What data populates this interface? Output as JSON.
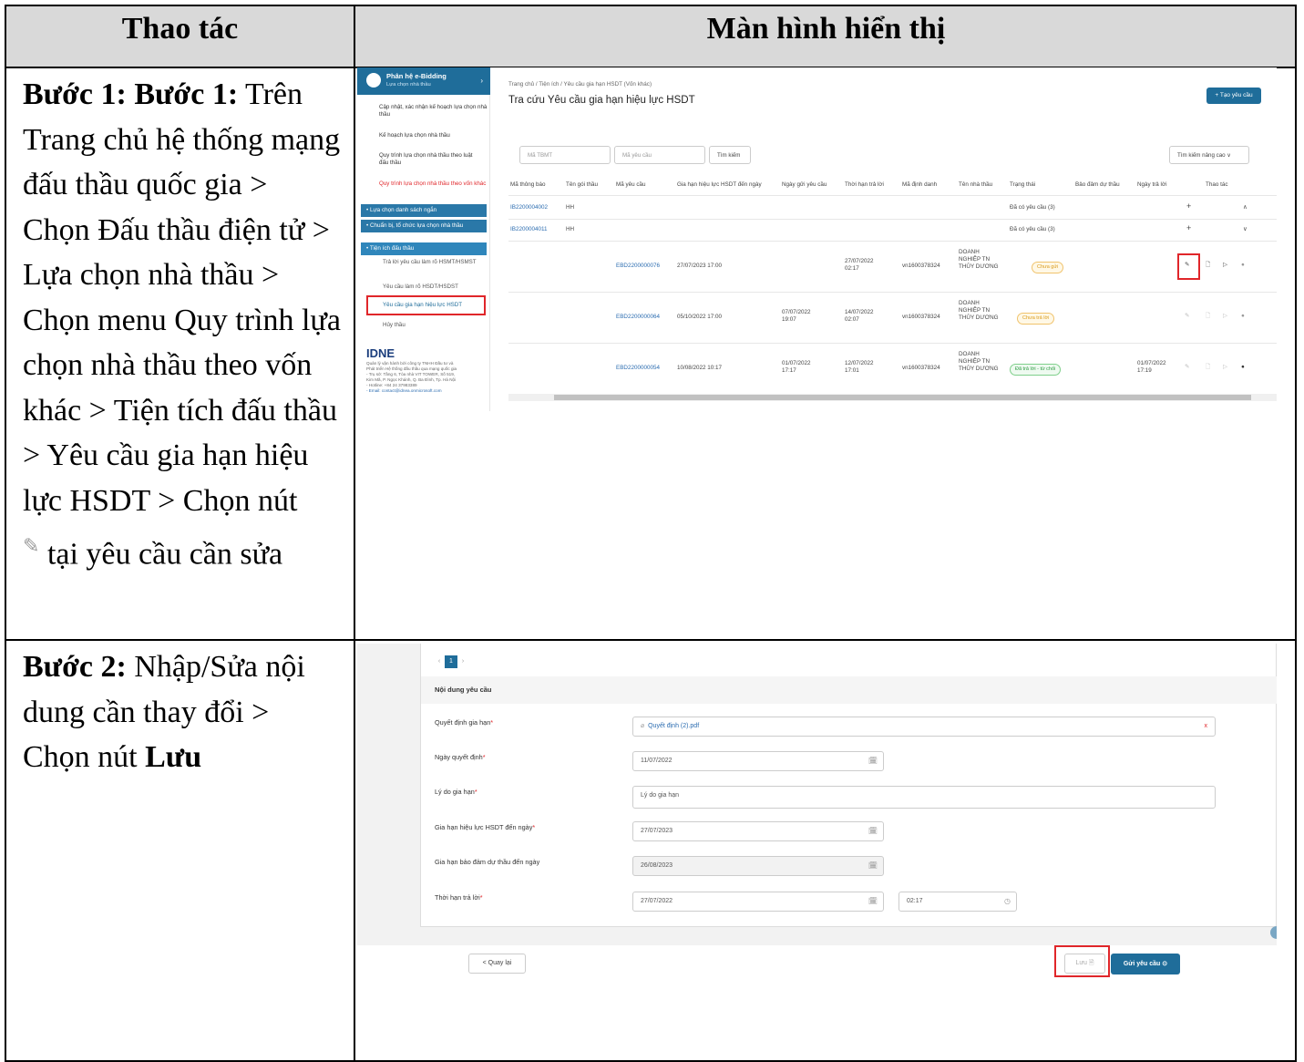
{
  "table": {
    "col_headers": [
      "Thao tác",
      "Màn hình hiển thị"
    ]
  },
  "steps": [
    {
      "lead": "Bước 1: Bước 1:",
      "text": "Trên Trang chủ hệ thống mạng đấu thầu quốc gia > Chọn Đấu thầu điện tử > Lựa chọn nhà thầu > Chọn menu Quy trình lựa chọn nhà thầu theo vốn khác > Tiện tích đấu thầu > Yêu cầu gia hạn hiệu lực HSDT > Chọn nút",
      "tail": "tại yêu cầu cần sửa",
      "icon": "pencil-icon"
    },
    {
      "lead": "Bước 2:",
      "text": "Nhập/Sửa nội dung cần thay đổi > Chọn nút",
      "bold_end": "Lưu"
    }
  ],
  "screen1": {
    "app_name": "Phân hệ e-Bidding",
    "app_sub": "Lựa chọn nhà thầu",
    "sidebar": [
      "Cập nhật, xác nhận kế hoạch lựa chọn nhà thầu",
      "Kế hoạch lựa chọn nhà thầu",
      "Quy trình lựa chọn nhà thầu theo luật đấu thầu",
      "Quy trình lựa chọn nhà thầu theo vốn khác",
      "Lựa chọn danh sách ngắn",
      "Chuẩn bị, tổ chức lựa chọn nhà thầu",
      "Tiện ích đấu thầu",
      "Trả lời yêu cầu làm rõ HSMT/HSMST",
      "Yêu cầu làm rõ HSDT/HSDST",
      "Yêu cầu gia hạn hiệu lực HSDT",
      "Hủy thầu"
    ],
    "logo": "IDNE",
    "footer": [
      "Quản lý vận hành bởi công ty TNHH Đầu tư và",
      "Phát triển Hệ thống đấu thầu qua mạng quốc gia",
      "- Trụ sở: Tầng 6, Tòa nhà VIT TOWER, Số 519,",
      "Kim Mã, P. Ngọc Khánh, Q. Ba Đình, Tp. Hà Nội",
      "- Hotline: +84 24 37983389",
      "- Email: contact@idnea.onmicrosoft.com"
    ],
    "breadcrumb": "Trang chủ / Tiện ích / Yêu cầu gia hạn HSDT (Vốn khác)",
    "title": "Tra cứu Yêu cầu gia hạn hiệu lực HSDT",
    "create_btn": "+ Tạo yêu cầu",
    "search": {
      "tbmt_ph": "Mã TBMT",
      "req_ph": "Mã yêu cầu",
      "btn": "Tìm kiếm",
      "adv": "Tìm kiếm nâng cao ∨"
    },
    "columns": [
      "Mã thông báo",
      "Tên gói thầu",
      "Mã yêu cầu",
      "Gia hạn hiệu lực HSDT đến ngày",
      "Ngày gửi yêu cầu",
      "Thời hạn trả lời",
      "Mã định danh",
      "Tên nhà thầu",
      "Trạng thái",
      "Bảo đảm dự thầu",
      "Ngày trả lời",
      "Thao tác"
    ],
    "groups": [
      {
        "code": "IB2200004002",
        "name": "HH",
        "status": "Đã có yêu cầu (3)",
        "toggle": "∧"
      },
      {
        "code": "IB2200004011",
        "name": "HH",
        "status": "Đã có yêu cầu (3)",
        "toggle": "∨"
      }
    ],
    "rows": [
      {
        "req": "EBD2200000076",
        "until": "27/07/2023 17:00",
        "sent": "",
        "reply_by": "27/07/2022 02:17",
        "id": "vn1600378324",
        "bidder": "DOANH NGHIỆP TN THỦY DƯƠNG",
        "status": "Chưa gửi",
        "answered": ""
      },
      {
        "req": "EBD2200000064",
        "until": "05/10/2022 17:00",
        "sent": "07/07/2022 19:07",
        "reply_by": "14/07/2022 02:07",
        "id": "vn1600378324",
        "bidder": "DOANH NGHIỆP TN THỦY DƯƠNG",
        "status": "Chưa trả lời",
        "answered": ""
      },
      {
        "req": "EBD2200000054",
        "until": "10/08/2022 10:17",
        "sent": "01/07/2022 17:17",
        "reply_by": "12/07/2022 17:01",
        "id": "vn1600378324",
        "bidder": "DOANH NGHIỆP TN THỦY DƯƠNG",
        "status": "Đã trả lời - từ chối",
        "answered": "01/07/2022 17:19"
      }
    ],
    "colors": {
      "primary": "#1f6d9a",
      "highlight": "#e0262a"
    }
  },
  "screen2": {
    "page": "1",
    "section": "Nội dung yêu cầu",
    "fields": [
      {
        "label": "Quyết định gia hạn",
        "value": "Quyết định (2).pdf"
      },
      {
        "label": "Ngày quyết định",
        "value": "11/07/2022"
      },
      {
        "label": "Lý do gia hạn",
        "value": "Lý do gia hạn"
      },
      {
        "label": "Gia hạn hiệu lực HSDT đến ngày",
        "value": "27/07/2023"
      },
      {
        "label": "Gia hạn bảo đảm dự thầu đến ngày",
        "value": "26/08/2023"
      },
      {
        "label": "Thời hạn trả lời",
        "value": "27/07/2022",
        "time": "02:17"
      }
    ],
    "back_btn": "< Quay lại",
    "save_btn": "Lưu",
    "send_btn": "Gửi yêu cầu"
  }
}
